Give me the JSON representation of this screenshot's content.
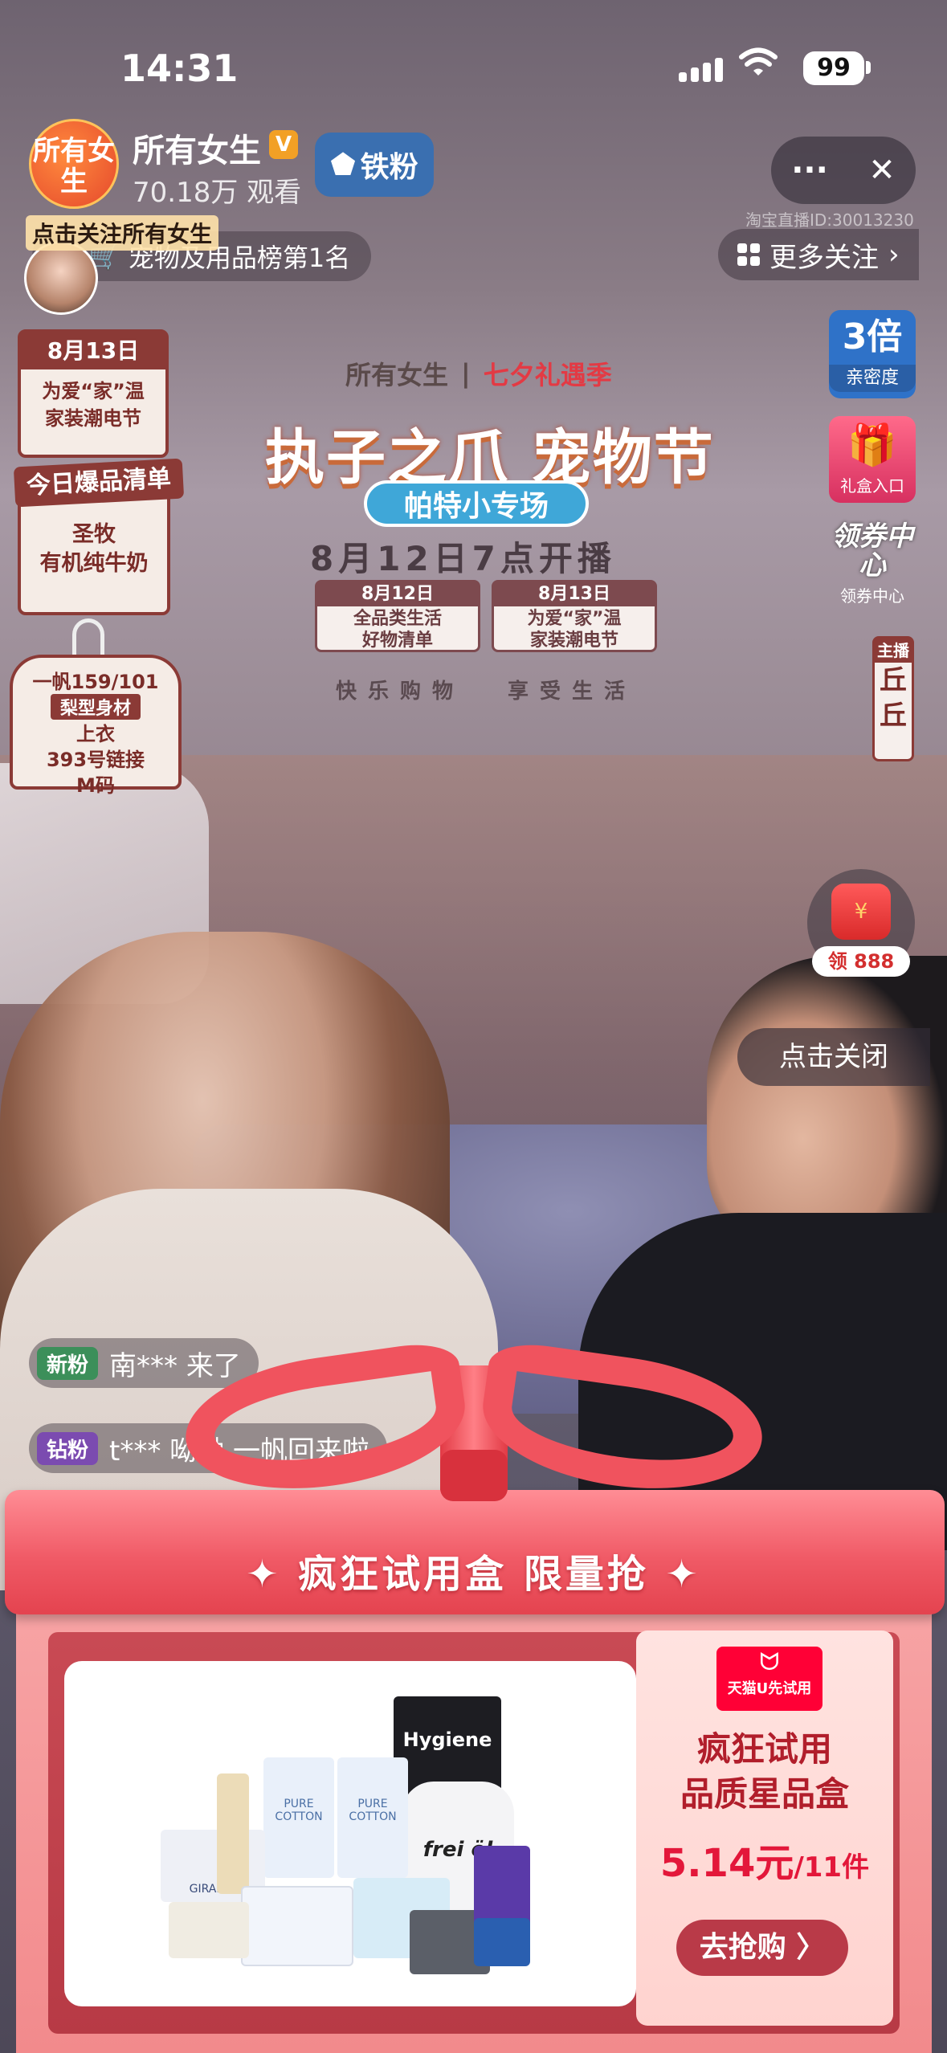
{
  "status_bar": {
    "time": "14:31",
    "battery": "99"
  },
  "host": {
    "avatar_text": "所有女生",
    "name": "所有女生",
    "viewers": "70.18万 观看",
    "fan_badge": "铁粉",
    "follow_tip": "点击关注所有女生",
    "rank": "宠物及用品榜第1名"
  },
  "top_right": {
    "more_icon": "···",
    "close_icon": "✕",
    "room_id": "淘宝直播ID:30013230",
    "more_follow": "更多关注",
    "more_follow_chevron": "›"
  },
  "left_cards": {
    "date_card": {
      "date": "8月13日",
      "line1": "为爱“家”温",
      "line2": "家装潮电节"
    },
    "hot_card": {
      "header": "今日爆品清单",
      "line1": "圣牧",
      "line2": "有机纯牛奶"
    },
    "shirt_card": {
      "line1": "一帆159/101",
      "tag": "梨型身材",
      "line2": "上衣",
      "line3": "393号链接",
      "line4": "M码"
    }
  },
  "banner": {
    "brand": "所有女生",
    "campaign": "七夕礼遇季",
    "title": "执子之爪 宠物节",
    "subtitle": "帕特小专场",
    "date": "8月12日7点开播",
    "card1": {
      "date": "8月12日",
      "line1": "全品类生活",
      "line2": "好物清单"
    },
    "card2": {
      "date": "8月13日",
      "line1": "为爱“家”温",
      "line2": "家装潮电节"
    },
    "slogan1": "快乐购物",
    "slogan2": "享受生活"
  },
  "right_widgets": {
    "intimacy_value": "3倍",
    "intimacy_label": "亲密度",
    "gift_label": "礼盒入口",
    "coupon_icon": "领券中心",
    "coupon_label": "领券中心",
    "host_label": "主播",
    "host_name": "丘丘",
    "redpack_symbol": "¥",
    "redpack_label": "领 888",
    "close_tip": "点击关闭"
  },
  "comments": [
    {
      "tag": "新粉",
      "tag_color": "#3c8f5a",
      "text": "南*** 来了"
    },
    {
      "tag": "钻粉",
      "tag_color": "#7b4bb0",
      "text": "t*** 呦呦 一帆回来啦"
    }
  ],
  "trial_box": {
    "title": "✦ 疯狂试用盒  限量抢 ✦",
    "tmall_tag": "天猫U先试用",
    "headline1": "疯狂试用",
    "headline2": "品质星品盒",
    "price": "5.14元",
    "count": "/11件",
    "cta": "去抢购 〉",
    "product_labels": [
      "Hygiene",
      "frei öl",
      "PURE COTTON",
      "PURE COTTON",
      "GIRAFFE"
    ]
  }
}
